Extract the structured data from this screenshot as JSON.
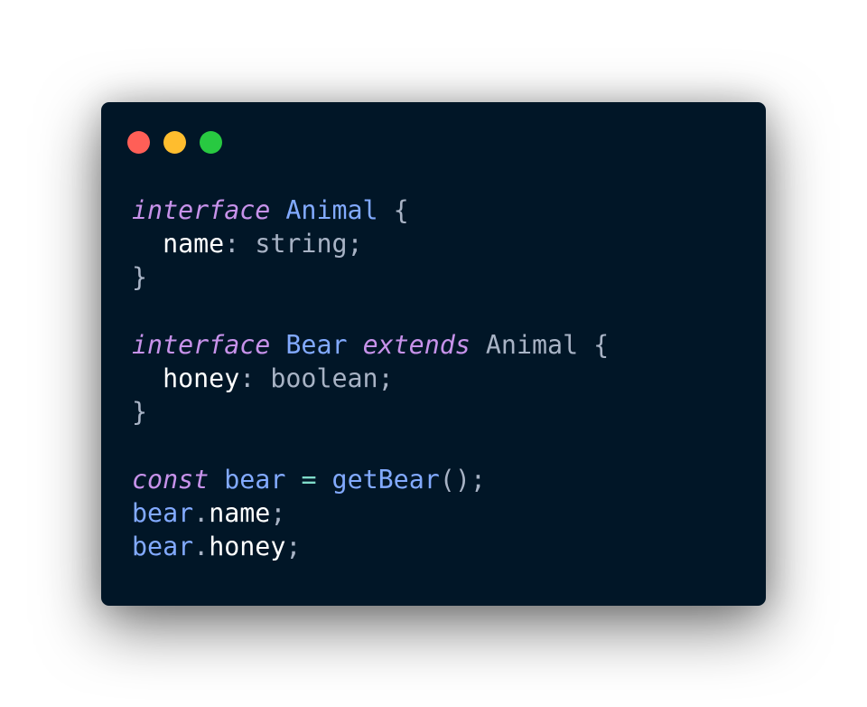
{
  "window": {
    "controls": [
      {
        "name": "close",
        "color": "#ff5f57"
      },
      {
        "name": "minimize",
        "color": "#ffbd2e"
      },
      {
        "name": "zoom",
        "color": "#28c941"
      }
    ]
  },
  "code": {
    "language": "typescript",
    "theme_colors": {
      "background": "#011627",
      "keyword": "#c792ea",
      "type": "#82aaff",
      "property": "#ffffff",
      "builtin_type": "#a8b3c5",
      "punctuation": "#a8b3c5",
      "operator": "#7fdbca"
    },
    "lines": [
      [
        {
          "text": "interface",
          "type": "kw"
        },
        {
          "text": " ",
          "type": "pl"
        },
        {
          "text": "Animal",
          "type": "ty"
        },
        {
          "text": " {",
          "type": "pu"
        }
      ],
      [
        {
          "text": "  ",
          "type": "pl"
        },
        {
          "text": "name",
          "type": "pr"
        },
        {
          "text": ": ",
          "type": "pu"
        },
        {
          "text": "string",
          "type": "bt"
        },
        {
          "text": ";",
          "type": "pu"
        }
      ],
      [
        {
          "text": "}",
          "type": "pu"
        }
      ],
      [],
      [
        {
          "text": "interface",
          "type": "kw"
        },
        {
          "text": " ",
          "type": "pl"
        },
        {
          "text": "Bear",
          "type": "ty"
        },
        {
          "text": " ",
          "type": "pl"
        },
        {
          "text": "extends",
          "type": "kw"
        },
        {
          "text": " ",
          "type": "pl"
        },
        {
          "text": "Animal",
          "type": "bt"
        },
        {
          "text": " {",
          "type": "pu"
        }
      ],
      [
        {
          "text": "  ",
          "type": "pl"
        },
        {
          "text": "honey",
          "type": "pr"
        },
        {
          "text": ": ",
          "type": "pu"
        },
        {
          "text": "boolean",
          "type": "bt"
        },
        {
          "text": ";",
          "type": "pu"
        }
      ],
      [
        {
          "text": "}",
          "type": "pu"
        }
      ],
      [],
      [
        {
          "text": "const",
          "type": "kw"
        },
        {
          "text": " ",
          "type": "pl"
        },
        {
          "text": "bear",
          "type": "ty"
        },
        {
          "text": " ",
          "type": "pl"
        },
        {
          "text": "=",
          "type": "op"
        },
        {
          "text": " ",
          "type": "pl"
        },
        {
          "text": "getBear",
          "type": "fn"
        },
        {
          "text": "();",
          "type": "pu"
        }
      ],
      [
        {
          "text": "bear",
          "type": "ty"
        },
        {
          "text": ".",
          "type": "pu"
        },
        {
          "text": "name",
          "type": "pr"
        },
        {
          "text": ";",
          "type": "pu"
        }
      ],
      [
        {
          "text": "bear",
          "type": "ty"
        },
        {
          "text": ".",
          "type": "pu"
        },
        {
          "text": "honey",
          "type": "pr"
        },
        {
          "text": ";",
          "type": "pu"
        }
      ]
    ]
  }
}
